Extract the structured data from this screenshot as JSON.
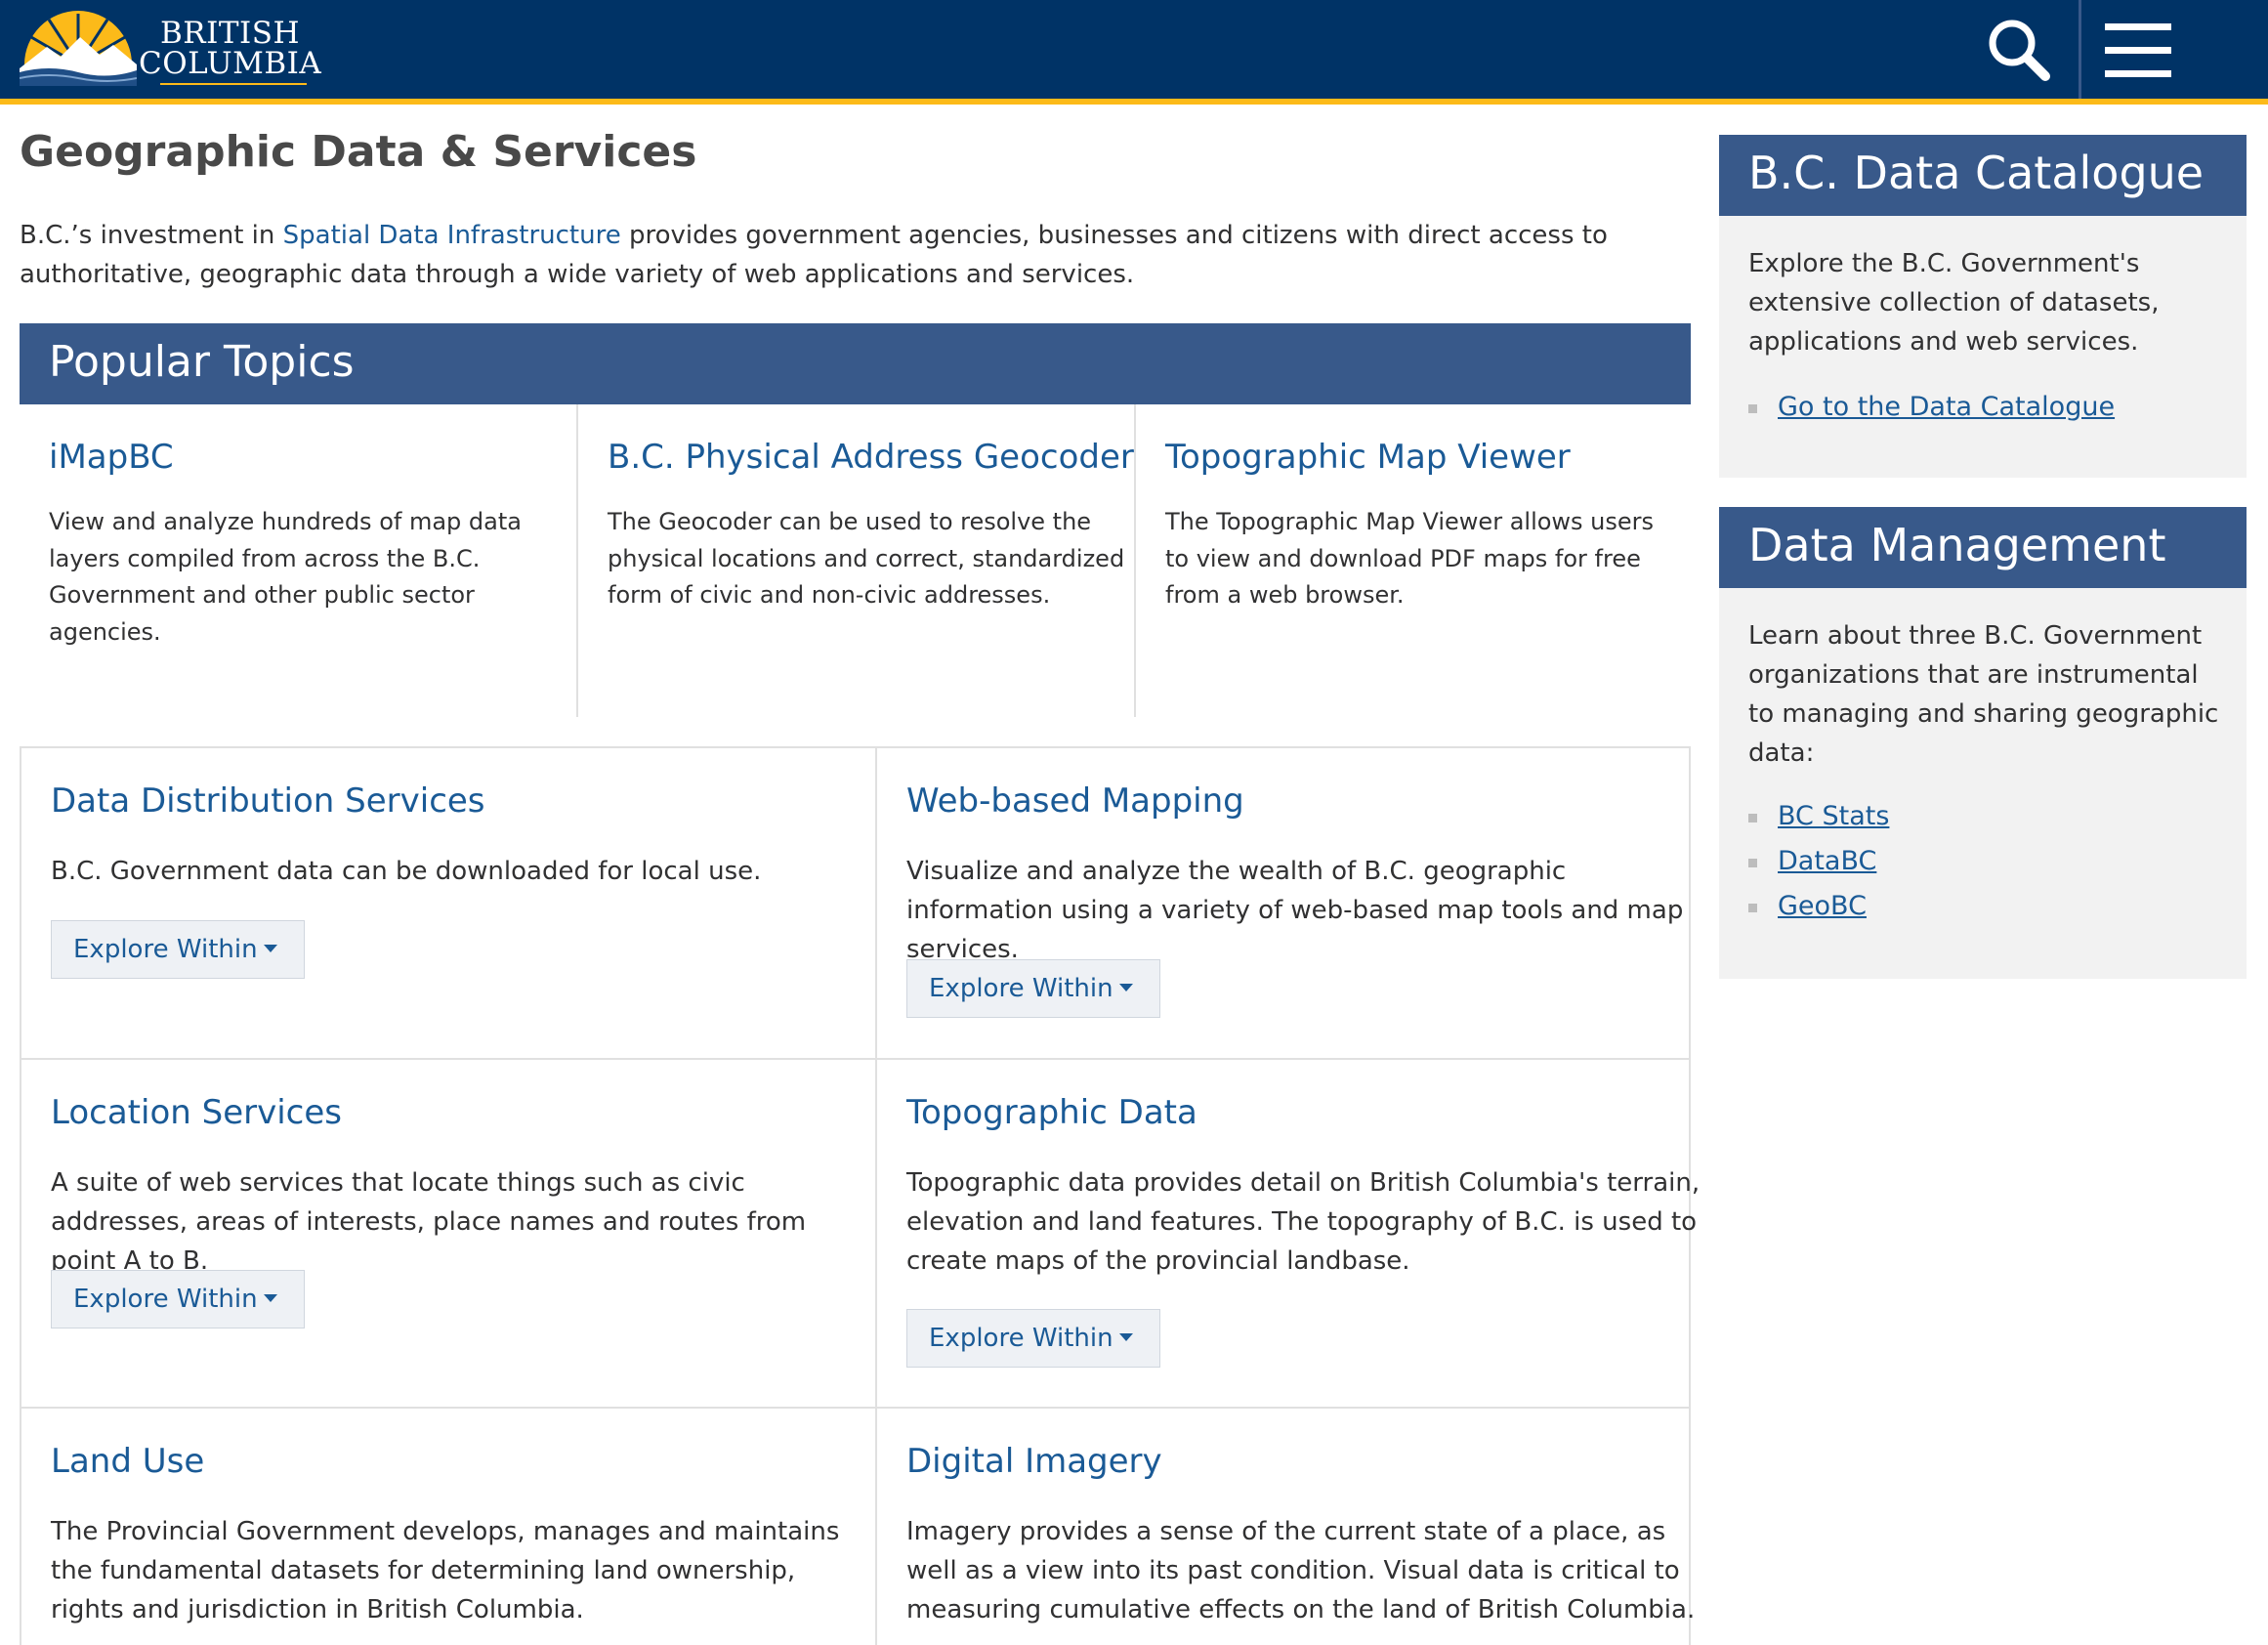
{
  "header": {
    "logo_line1": "BRITISH",
    "logo_line2": "COLUMBIA",
    "search_icon": "search-icon",
    "menu_icon": "hamburger-menu-icon",
    "colors": {
      "bar": "#003366",
      "accent": "#fcba19"
    }
  },
  "page": {
    "title": "Geographic Data & Services",
    "intro_before": "B.C.’s investment in ",
    "intro_link": "Spatial Data Infrastructure",
    "intro_after": " provides government agencies, businesses and citizens with direct access to authoritative, geographic data through a wide variety of web applications and services."
  },
  "popular": {
    "heading": "Popular Topics",
    "topics": [
      {
        "title": "iMapBC",
        "text": "View and analyze hundreds of map data layers compiled from across the B.C. Government and other public sector agencies."
      },
      {
        "title": "B.C. Physical Address Geocoder",
        "text": "The Geocoder can be used to resolve the physical locations and correct, standardized form of civic and non-civic addresses."
      },
      {
        "title": "Topographic Map Viewer",
        "text": "The Topographic Map Viewer allows users to view and download PDF maps for free from a web browser."
      }
    ]
  },
  "sections": [
    {
      "title": "Data Distribution Services",
      "text": "B.C. Government data can be downloaded for local use.",
      "button": "Explore Within"
    },
    {
      "title": "Web-based Mapping",
      "text": "Visualize and analyze the wealth of B.C. geographic information using a variety of web-based map tools and map services.",
      "button": "Explore Within"
    },
    {
      "title": "Location Services",
      "text": "A suite of web services that locate things such as civic addresses, areas of interests, place names and routes from point A to B.",
      "button": "Explore Within"
    },
    {
      "title": "Topographic Data",
      "text": "Topographic data provides detail on British Columbia's terrain, elevation and land features. The topography of B.C. is used to create maps of the provincial landbase.",
      "button": "Explore Within"
    },
    {
      "title": "Land Use",
      "text": "The Provincial Government develops, manages and maintains the fundamental datasets for determining land ownership, rights and jurisdiction in British Columbia."
    },
    {
      "title": "Digital Imagery",
      "text": "Imagery provides a sense of the current state of a place, as well as a view into its past condition. Visual data is critical to measuring cumulative effects on the land of British Columbia."
    }
  ],
  "sidebar": {
    "catalogue": {
      "heading": "B.C. Data Catalogue",
      "text": "Explore the B.C. Government's extensive collection of datasets, applications and web services.",
      "links": [
        "Go to the Data Catalogue"
      ]
    },
    "management": {
      "heading": "Data Management",
      "text": "Learn about three B.C. Government organizations that are instrumental to managing and sharing geographic data:",
      "links": [
        "BC Stats",
        "DataBC",
        "GeoBC"
      ]
    }
  }
}
